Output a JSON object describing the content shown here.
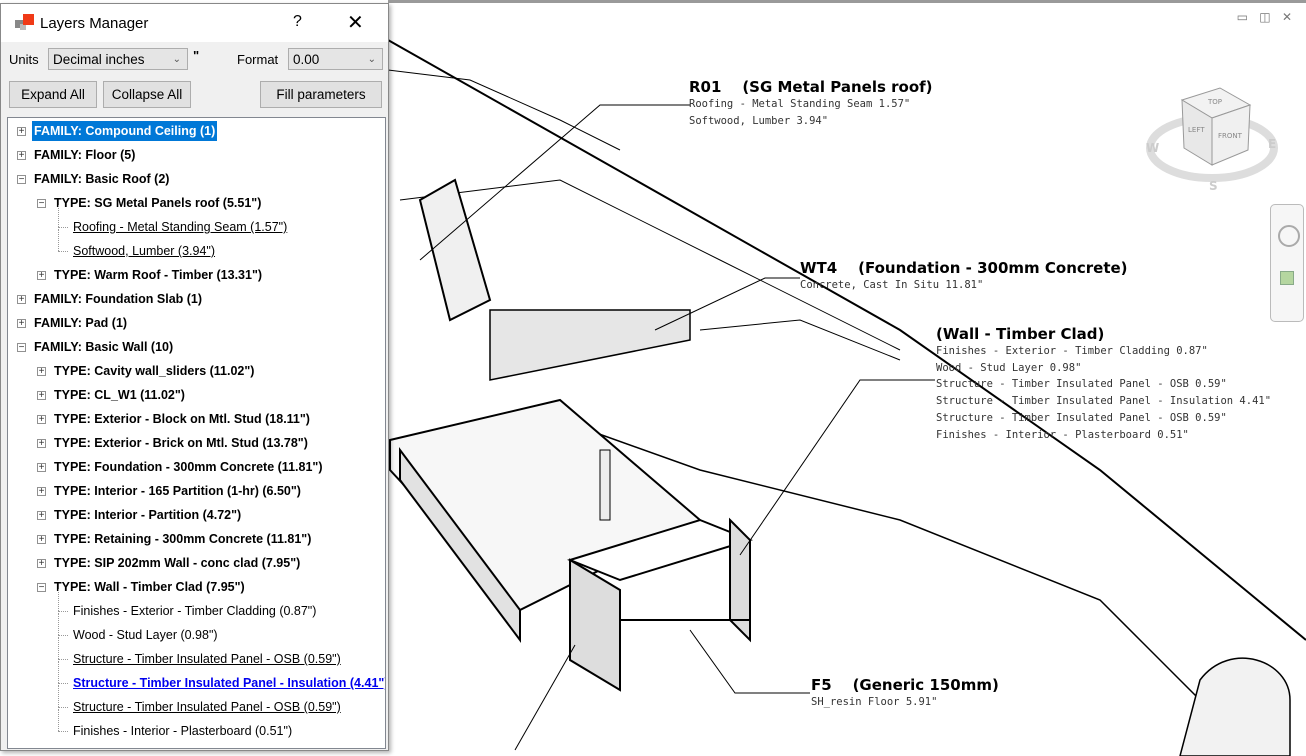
{
  "dialog": {
    "title": "Layers Manager",
    "help_label": "?",
    "close_label": "✕",
    "units_label": "Units",
    "units_value": "Decimal inches",
    "units_symbol": "\"",
    "format_label": "Format",
    "format_value": "0.00",
    "expand_all": "Expand All",
    "collapse_all": "Collapse All",
    "fill_parameters": "Fill parameters",
    "accent": "#0078d7"
  },
  "tree": [
    {
      "level": 0,
      "exp": "+",
      "label": "FAMILY: Compound Ceiling (1)",
      "style": "bold sel"
    },
    {
      "level": 0,
      "exp": "+",
      "label": "FAMILY: Floor (5)",
      "style": "bold"
    },
    {
      "level": 0,
      "exp": "-",
      "label": "FAMILY: Basic Roof (2)",
      "style": "bold"
    },
    {
      "level": 1,
      "exp": "-",
      "label": "TYPE: SG Metal Panels roof (5.51\")",
      "style": "bold"
    },
    {
      "level": 2,
      "exp": "",
      "label": "Roofing - Metal Standing Seam (1.57\")",
      "style": "ul"
    },
    {
      "level": 2,
      "exp": "",
      "label": "Softwood, Lumber (3.94\")",
      "style": "ul"
    },
    {
      "level": 1,
      "exp": "+",
      "label": "TYPE: Warm Roof - Timber (13.31\")",
      "style": "bold"
    },
    {
      "level": 0,
      "exp": "+",
      "label": "FAMILY: Foundation Slab (1)",
      "style": "bold"
    },
    {
      "level": 0,
      "exp": "+",
      "label": "FAMILY: Pad (1)",
      "style": "bold"
    },
    {
      "level": 0,
      "exp": "-",
      "label": "FAMILY: Basic Wall (10)",
      "style": "bold"
    },
    {
      "level": 1,
      "exp": "+",
      "label": "TYPE: Cavity wall_sliders (11.02\")",
      "style": "bold"
    },
    {
      "level": 1,
      "exp": "+",
      "label": "TYPE: CL_W1 (11.02\")",
      "style": "bold"
    },
    {
      "level": 1,
      "exp": "+",
      "label": "TYPE: Exterior - Block on Mtl. Stud (18.11\")",
      "style": "bold"
    },
    {
      "level": 1,
      "exp": "+",
      "label": "TYPE: Exterior - Brick on Mtl. Stud (13.78\")",
      "style": "bold"
    },
    {
      "level": 1,
      "exp": "+",
      "label": "TYPE: Foundation - 300mm Concrete (11.81\")",
      "style": "bold"
    },
    {
      "level": 1,
      "exp": "+",
      "label": "TYPE: Interior - 165 Partition (1-hr) (6.50\")",
      "style": "bold"
    },
    {
      "level": 1,
      "exp": "+",
      "label": "TYPE: Interior - Partition (4.72\")",
      "style": "bold"
    },
    {
      "level": 1,
      "exp": "+",
      "label": "TYPE: Retaining - 300mm Concrete (11.81\")",
      "style": "bold"
    },
    {
      "level": 1,
      "exp": "+",
      "label": "TYPE: SIP 202mm Wall - conc clad (7.95\")",
      "style": "bold"
    },
    {
      "level": 1,
      "exp": "-",
      "label": "TYPE: Wall - Timber Clad (7.95\")",
      "style": "bold"
    },
    {
      "level": 2,
      "exp": "",
      "label": "Finishes - Exterior - Timber Cladding (0.87\")",
      "style": ""
    },
    {
      "level": 2,
      "exp": "",
      "label": "Wood - Stud Layer (0.98\")",
      "style": ""
    },
    {
      "level": 2,
      "exp": "",
      "label": "Structure - Timber Insulated Panel - OSB (0.59\")",
      "style": "ul"
    },
    {
      "level": 2,
      "exp": "",
      "label": "Structure - Timber Insulated Panel - Insulation (4.41\")",
      "style": "link"
    },
    {
      "level": 2,
      "exp": "",
      "label": "Structure - Timber Insulated Panel - OSB (0.59\")",
      "style": "ul"
    },
    {
      "level": 2,
      "exp": "",
      "label": "Finishes - Interior - Plasterboard (0.51\")",
      "style": ""
    }
  ],
  "annotations": [
    {
      "title": "R01    (SG Metal Panels roof)",
      "lines": [
        "Roofing - Metal Standing Seam 1.57\"",
        "Softwood, Lumber 3.94\""
      ]
    },
    {
      "title": "WT4    (Foundation - 300mm Concrete)",
      "lines": [
        "Concrete, Cast In Situ 11.81\""
      ]
    },
    {
      "title": "(Wall - Timber Clad)",
      "lines": [
        "Finishes - Exterior - Timber Cladding 0.87\"",
        "Wood - Stud Layer 0.98\"",
        "Structure - Timber Insulated Panel - OSB 0.59\"",
        "Structure - Timber Insulated Panel - Insulation 4.41\"",
        "Structure - Timber Insulated Panel - OSB 0.59\"",
        "Finishes - Interior - Plasterboard 0.51\""
      ]
    },
    {
      "title": "F5    (Generic 150mm)",
      "lines": [
        "SH_resin Floor 5.91\""
      ]
    }
  ],
  "viewcube": {
    "top": "TOP",
    "left": "LEFT",
    "front": "FRONT",
    "w": "W",
    "e": "E",
    "s": "S"
  },
  "viewport_controls": "▭ ◫ ✕"
}
